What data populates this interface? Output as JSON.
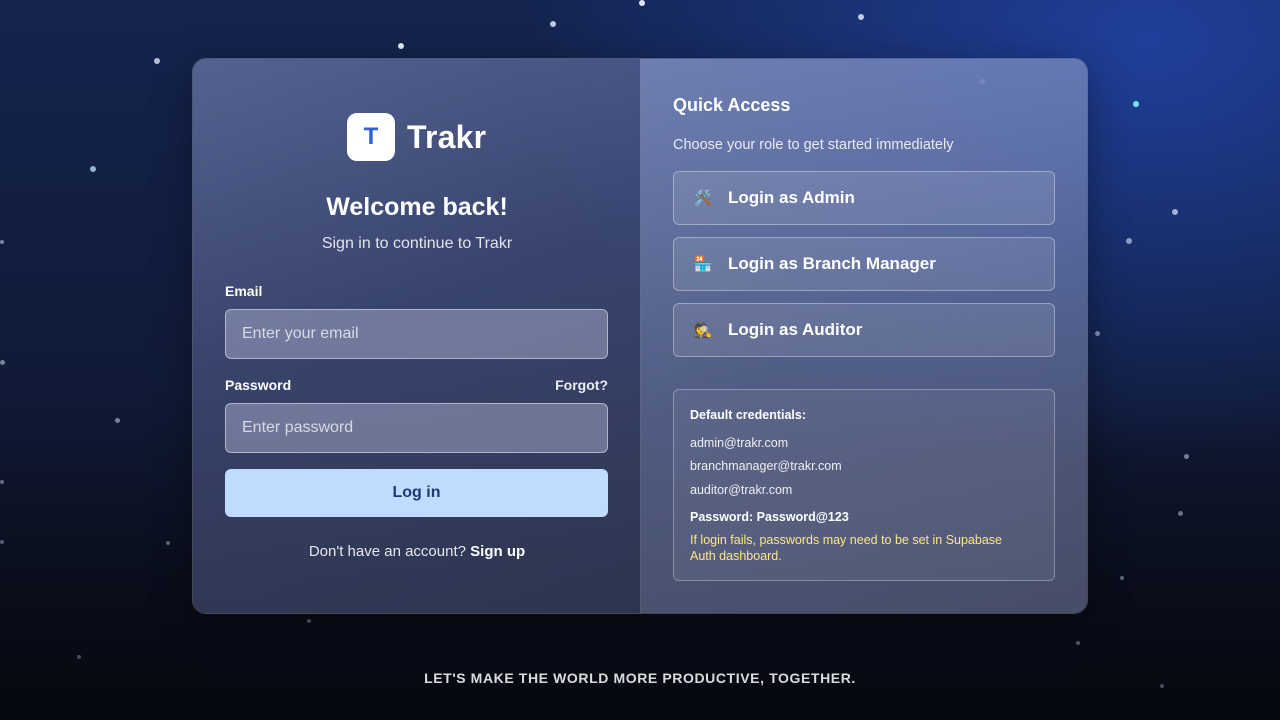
{
  "brand": {
    "logo_letter": "T",
    "name": "Trakr"
  },
  "login": {
    "title": "Welcome back!",
    "subtitle": "Sign in to continue to Trakr",
    "email_label": "Email",
    "email_placeholder": "Enter your email",
    "email_value": "",
    "password_label": "Password",
    "forgot_label": "Forgot?",
    "password_placeholder": "Enter password",
    "password_value": "",
    "submit_label": "Log in",
    "signup_prompt": "Don't have an account?",
    "signup_link": "Sign up"
  },
  "quick_access": {
    "title": "Quick Access",
    "subtitle": "Choose your role to get started immediately",
    "roles": [
      {
        "icon": "tools-icon",
        "glyph": "🛠️",
        "label": "Login as Admin"
      },
      {
        "icon": "store-icon",
        "glyph": "🏪",
        "label": "Login as Branch Manager"
      },
      {
        "icon": "detective-icon",
        "glyph": "🕵️",
        "label": "Login as Auditor"
      }
    ]
  },
  "credentials": {
    "title": "Default credentials:",
    "emails": [
      "admin@trakr.com",
      "branchmanager@trakr.com",
      "auditor@trakr.com"
    ],
    "password_line": "Password: Password@123",
    "warning": "If login fails, passwords may need to be set in Supabase Auth dashboard."
  },
  "footer": {
    "tagline": "LET'S MAKE THE WORLD MORE PRODUCTIVE, TOGETHER."
  },
  "colors": {
    "accent": "#2d63d8",
    "login_button": "#bfdbfe",
    "warning_text": "#fde68a"
  }
}
